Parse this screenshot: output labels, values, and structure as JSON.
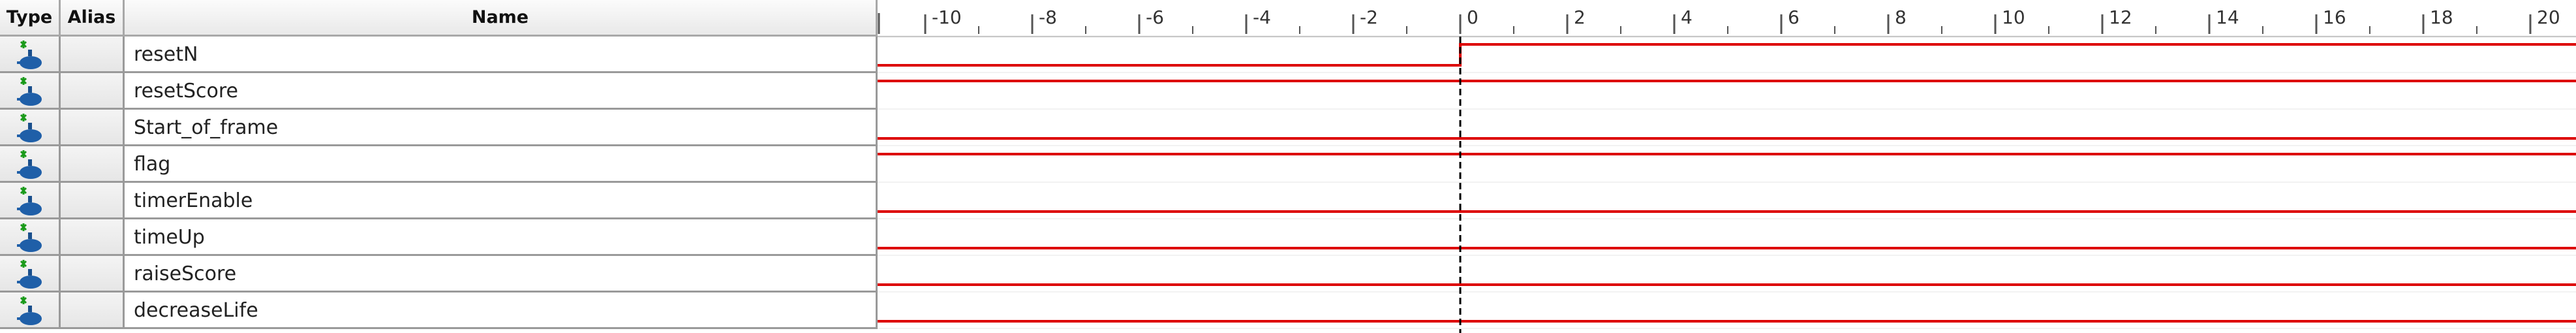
{
  "header": {
    "type_label": "Type",
    "alias_label": "Alias",
    "name_label": "Name"
  },
  "signals": [
    {
      "name": "resetN",
      "icon": "input-pin-icon",
      "transitions": [
        {
          "t": -11,
          "v": 0
        },
        {
          "t": 0,
          "v": 1
        }
      ]
    },
    {
      "name": "resetScore",
      "icon": "input-pin-icon",
      "transitions": [
        {
          "t": -11,
          "v": 1
        }
      ]
    },
    {
      "name": "Start_of_frame",
      "icon": "input-pin-icon",
      "transitions": [
        {
          "t": -11,
          "v": 0
        }
      ]
    },
    {
      "name": "flag",
      "icon": "input-pin-icon",
      "transitions": [
        {
          "t": -11,
          "v": 1
        }
      ]
    },
    {
      "name": "timerEnable",
      "icon": "input-pin-icon",
      "transitions": [
        {
          "t": -11,
          "v": 0
        }
      ]
    },
    {
      "name": "timeUp",
      "icon": "input-pin-icon",
      "transitions": [
        {
          "t": -11,
          "v": 0
        }
      ]
    },
    {
      "name": "raiseScore",
      "icon": "input-pin-icon",
      "transitions": [
        {
          "t": -11,
          "v": 0
        }
      ]
    },
    {
      "name": "decreaseLife",
      "icon": "input-pin-icon",
      "transitions": [
        {
          "t": -11,
          "v": 0
        }
      ]
    }
  ],
  "timeline": {
    "tick_labels": [
      "-10",
      "-8",
      "-6",
      "-4",
      "-2",
      "0",
      "2",
      "4",
      "6",
      "8",
      "10",
      "12",
      "14",
      "16",
      "18",
      "20"
    ],
    "range": [
      -11,
      21
    ],
    "cursor_time": 0
  },
  "colors": {
    "signal": "#dd0000",
    "cursor": "#000000"
  }
}
